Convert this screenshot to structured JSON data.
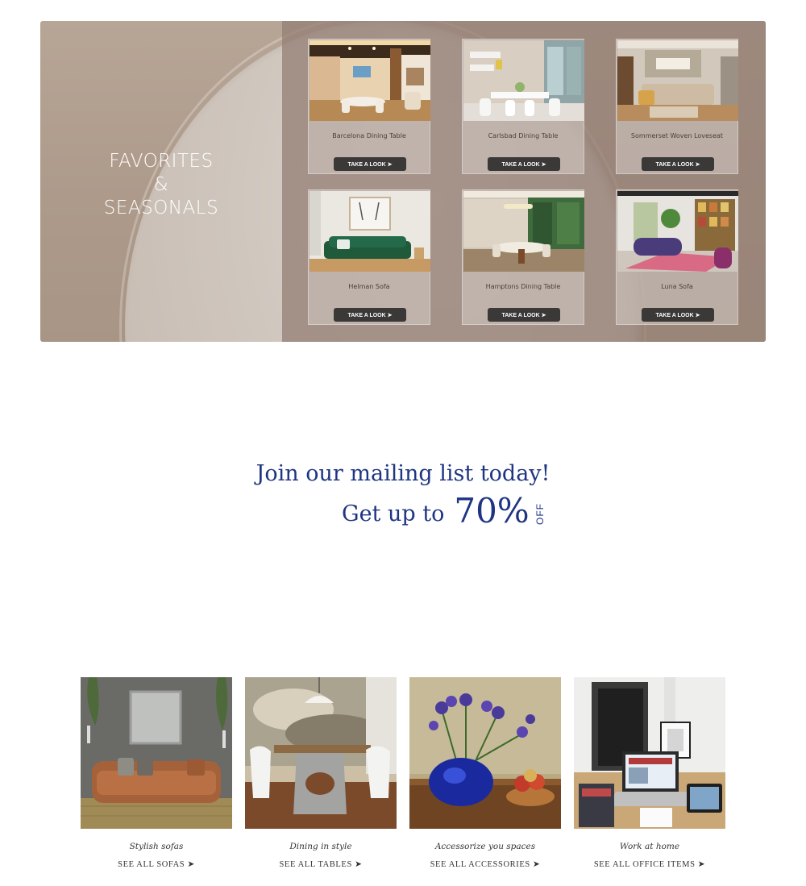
{
  "hero": {
    "title_line1": "FAVORITES",
    "title_line2": "&",
    "title_line3": "SEASONALS",
    "cards": [
      {
        "name": "Barcelona Dining Table",
        "button": "TAKE A LOOK ➤"
      },
      {
        "name": "Carlsbad Dining Table",
        "button": "TAKE A LOOK ➤"
      },
      {
        "name": "Sommerset Woven Loveseat",
        "button": "TAKE A LOOK ➤"
      },
      {
        "name": "Helman Sofa",
        "button": "TAKE A LOOK ➤"
      },
      {
        "name": "Hamptons Dining Table",
        "button": "TAKE A LOOK ➤"
      },
      {
        "name": "Luna Sofa",
        "button": "TAKE A LOOK ➤"
      }
    ]
  },
  "mailing": {
    "headline": "Join our mailing list today!",
    "get_up_to": "Get up to",
    "percent": "70%",
    "off": "OFF"
  },
  "categories": [
    {
      "title": "Stylish sofas",
      "link": "SEE ALL SOFAS ➤"
    },
    {
      "title": "Dining in style",
      "link": "SEE ALL TABLES ➤"
    },
    {
      "title": "Accessorize you spaces",
      "link": "SEE ALL ACCESSORIES ➤"
    },
    {
      "title": "Work at home",
      "link": "SEE ALL OFFICE ITEMS ➤"
    }
  ],
  "colors": {
    "accent_blue": "#1e3582",
    "button_dark": "#3b3838",
    "hero_tan": "#b1a091"
  }
}
